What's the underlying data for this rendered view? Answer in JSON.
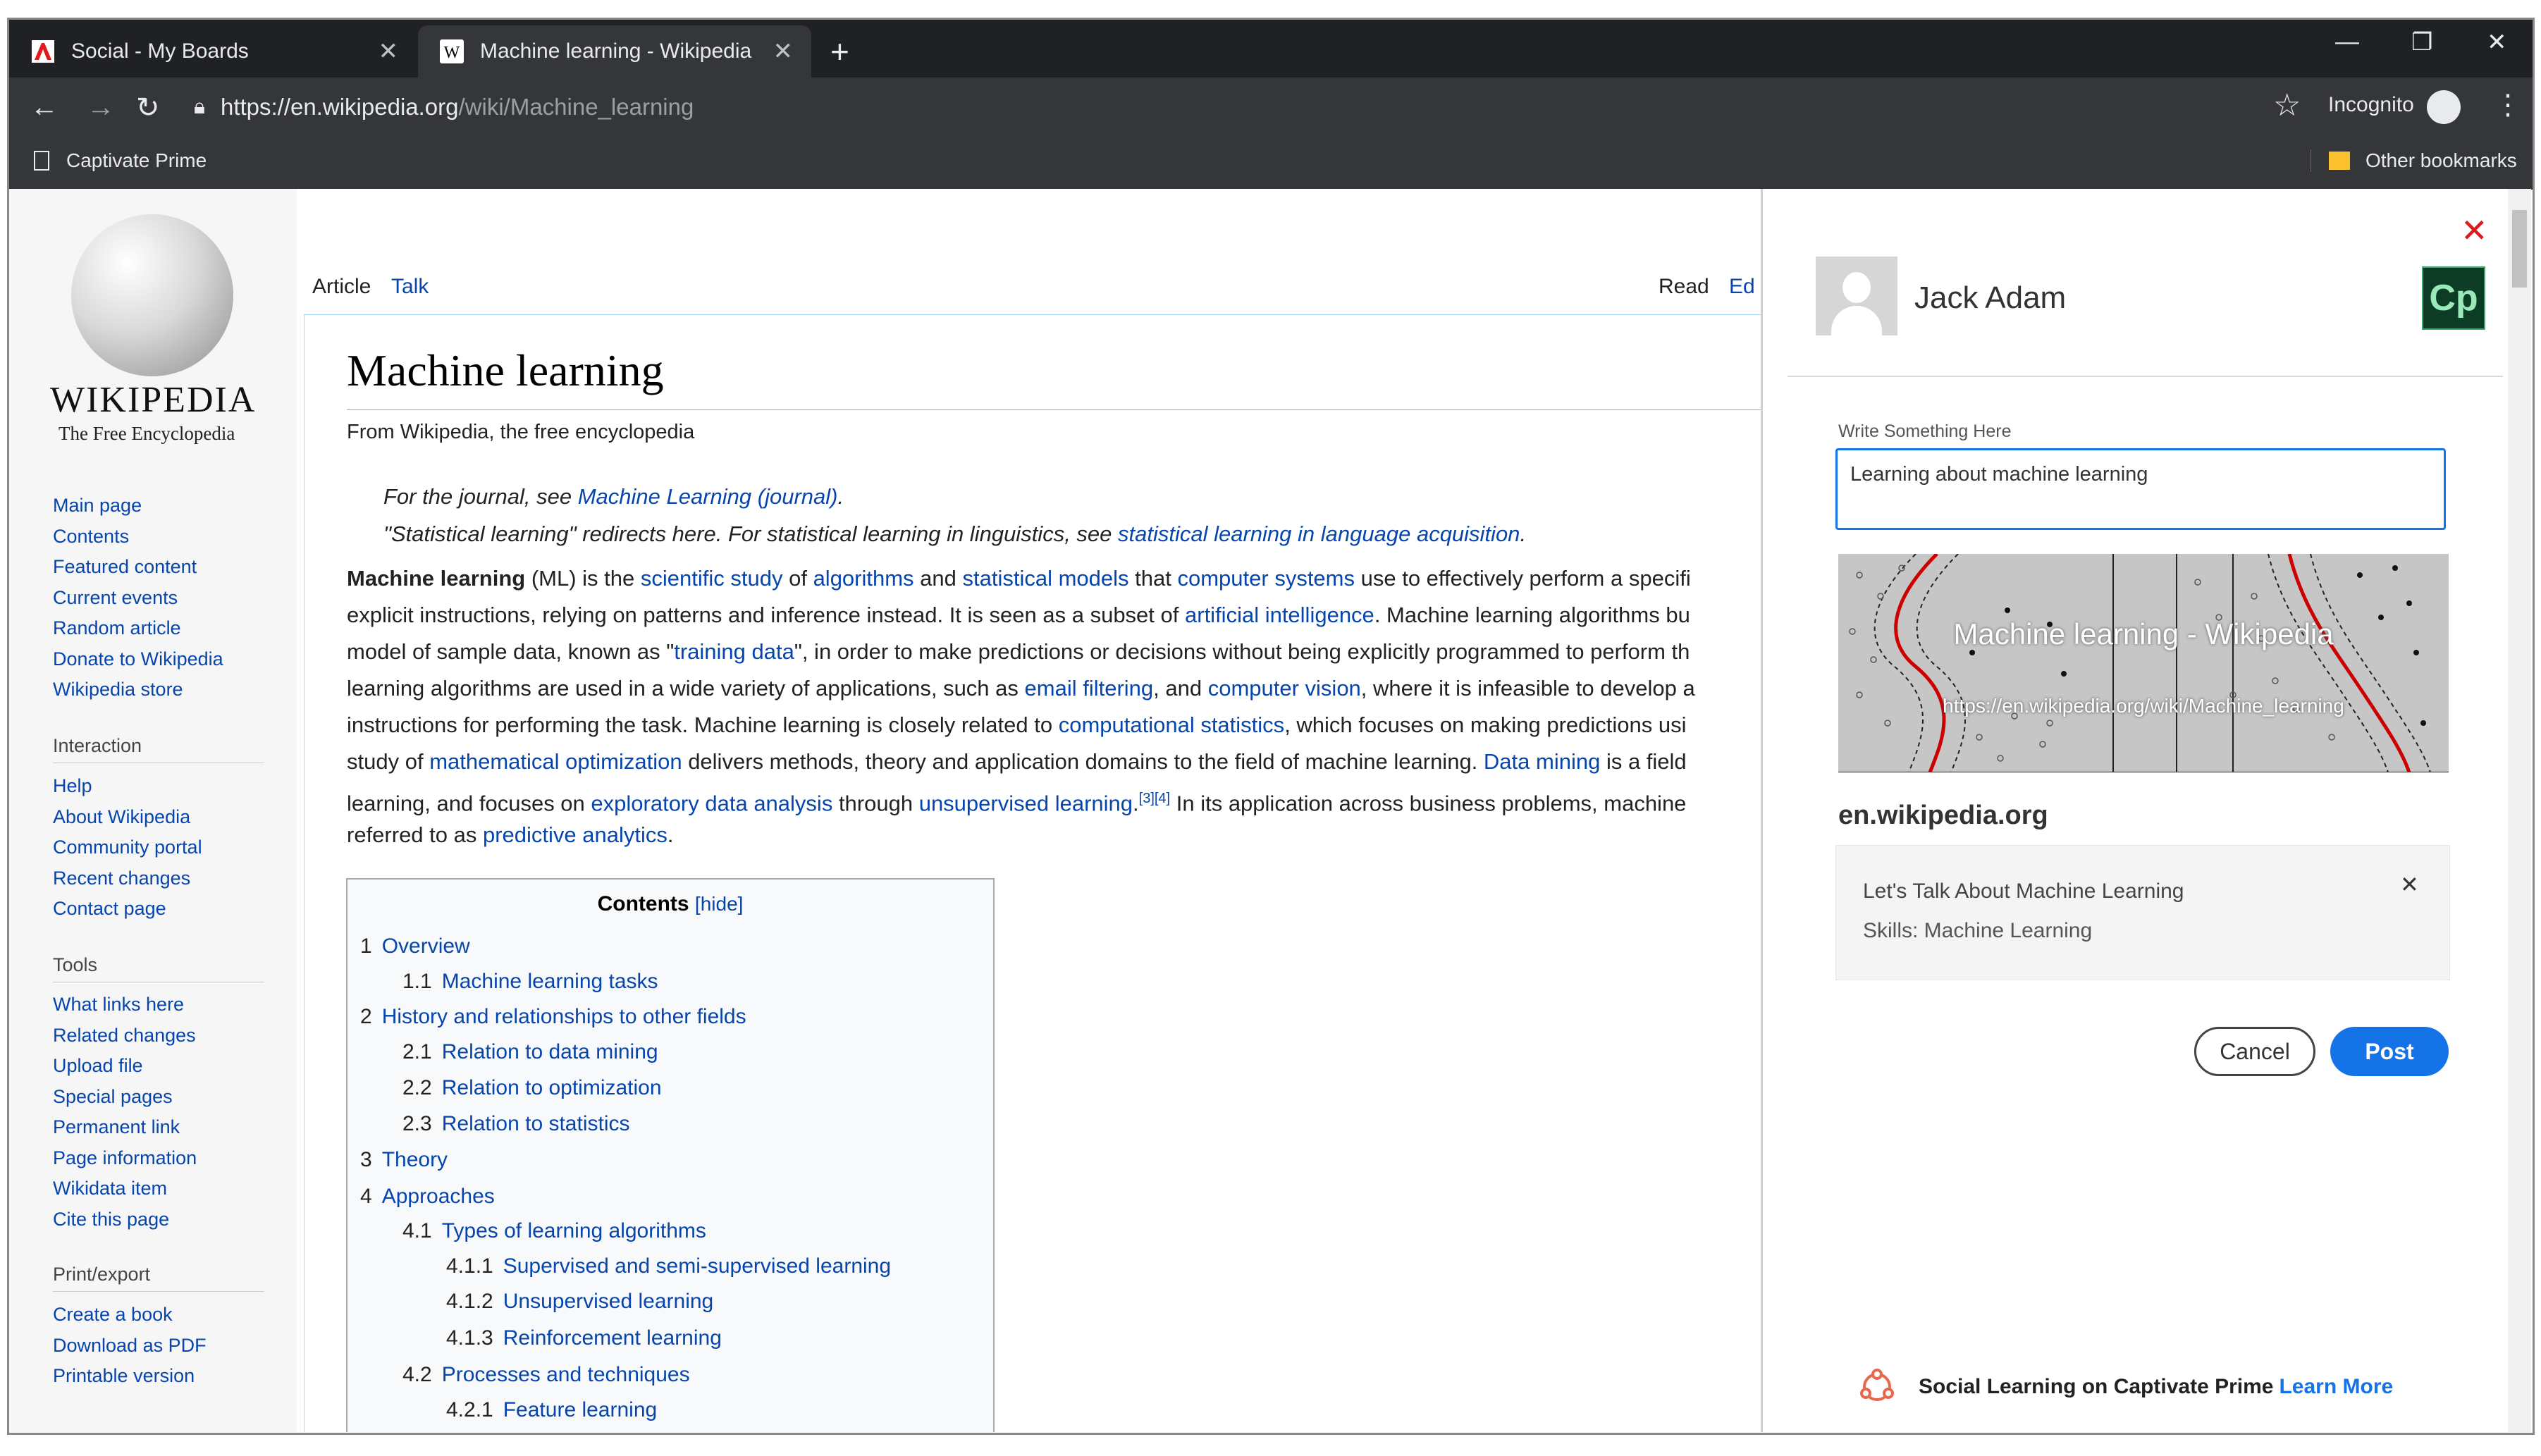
{
  "browser": {
    "tabs": [
      {
        "title": "Social - My Boards"
      },
      {
        "title": "Machine learning - Wikipedia"
      }
    ],
    "url_host": "https://en.wikipedia.org",
    "url_path": "/wiki/Machine_learning",
    "incognito_label": "Incognito",
    "bookmarks": {
      "left": "Captivate Prime",
      "right": "Other bookmarks"
    }
  },
  "wiki": {
    "logo_title": "WIKIPEDIA",
    "logo_tagline": "The Free Encyclopedia",
    "nav_main": [
      "Main page",
      "Contents",
      "Featured content",
      "Current events",
      "Random article",
      "Donate to Wikipedia",
      "Wikipedia store"
    ],
    "interaction_heading": "Interaction",
    "nav_interaction": [
      "Help",
      "About Wikipedia",
      "Community portal",
      "Recent changes",
      "Contact page"
    ],
    "tools_heading": "Tools",
    "nav_tools": [
      "What links here",
      "Related changes",
      "Upload file",
      "Special pages",
      "Permanent link",
      "Page information",
      "Wikidata item",
      "Cite this page"
    ],
    "print_heading": "Print/export",
    "nav_print": [
      "Create a book",
      "Download as PDF",
      "Printable version"
    ],
    "tabs": {
      "article": "Article",
      "talk": "Talk",
      "read": "Read",
      "edit": "Ed"
    },
    "title": "Machine learning",
    "subtitle": "From Wikipedia, the free encyclopedia",
    "hatnote1": {
      "pre": "For the journal, see ",
      "link": "Machine Learning (journal)",
      "post": "."
    },
    "hatnote2": {
      "pre": "\"Statistical learning\" redirects here. For statistical learning in linguistics, see ",
      "link": "statistical learning in language acquisition",
      "post": "."
    },
    "p1": {
      "bold": "Machine learning",
      "a": " (ML) is the ",
      "l1": "scientific study",
      "b": " of ",
      "l2": "algorithms",
      "c": " and ",
      "l3": "statistical models",
      "d": " that ",
      "l4": "computer systems",
      "e": " use to effectively perform a specifi"
    },
    "p2": {
      "a": "explicit instructions, relying on patterns and inference instead. It is seen as a subset of ",
      "l1": "artificial intelligence",
      "b": ". Machine learning algorithms bu"
    },
    "p3": {
      "a": "model of sample data, known as \"",
      "l1": "training data",
      "b": "\", in order to make predictions or decisions without being explicitly programmed to perform th"
    },
    "p4": {
      "a": "learning algorithms are used in a wide variety of applications, such as ",
      "l1": "email filtering",
      "b": ", and ",
      "l2": "computer vision",
      "c": ", where it is infeasible to develop a"
    },
    "p5": {
      "a": "instructions for performing the task. Machine learning is closely related to ",
      "l1": "computational statistics",
      "b": ", which focuses on making predictions usi"
    },
    "p6": {
      "a": "study of ",
      "l1": "mathematical optimization",
      "b": " delivers methods, theory and application domains to the field of machine learning. ",
      "l2": "Data mining",
      "c": " is a field"
    },
    "p7": {
      "a": "learning, and focuses on ",
      "l1": "exploratory data analysis",
      "b": " through ",
      "l2": "unsupervised learning",
      "c": ".",
      "sup": "[3][4]",
      "d": " In its application across business problems, machine"
    },
    "p8": {
      "a": "referred to as ",
      "l1": "predictive analytics",
      "b": "."
    },
    "toc": {
      "title": "Contents",
      "hide": "[hide]",
      "items": [
        {
          "num": "1",
          "text": "Overview"
        },
        {
          "num": "1.1",
          "text": "Machine learning tasks"
        },
        {
          "num": "2",
          "text": "History and relationships to other fields"
        },
        {
          "num": "2.1",
          "text": "Relation to data mining"
        },
        {
          "num": "2.2",
          "text": "Relation to optimization"
        },
        {
          "num": "2.3",
          "text": "Relation to statistics"
        },
        {
          "num": "3",
          "text": "Theory"
        },
        {
          "num": "4",
          "text": "Approaches"
        },
        {
          "num": "4.1",
          "text": "Types of learning algorithms"
        },
        {
          "num": "4.1.1",
          "text": "Supervised and semi-supervised learning"
        },
        {
          "num": "4.1.2",
          "text": "Unsupervised learning"
        },
        {
          "num": "4.1.3",
          "text": "Reinforcement learning"
        },
        {
          "num": "4.2",
          "text": "Processes and techniques"
        },
        {
          "num": "4.2.1",
          "text": "Feature learning"
        }
      ]
    }
  },
  "social": {
    "user_name": "Jack Adam",
    "cp_logo": "Cp",
    "write_label": "Write Something Here",
    "post_text": "Learning about machine learning",
    "preview_title": "Machine learning - Wikipedia",
    "preview_url": "https://en.wikipedia.org/wiki/Machine_learning",
    "domain": "en.wikipedia.org",
    "skill_title": "Let's Talk About Machine Learning",
    "skill_sub": "Skills: Machine Learning",
    "cancel": "Cancel",
    "post": "Post",
    "footer_text": "Social Learning on Captivate Prime",
    "footer_link": "Learn More"
  },
  "colors": {
    "accent": "#1473e6",
    "close": "#e0191c",
    "wiki_link": "#0645ad",
    "chrome_dark": "#202124"
  }
}
